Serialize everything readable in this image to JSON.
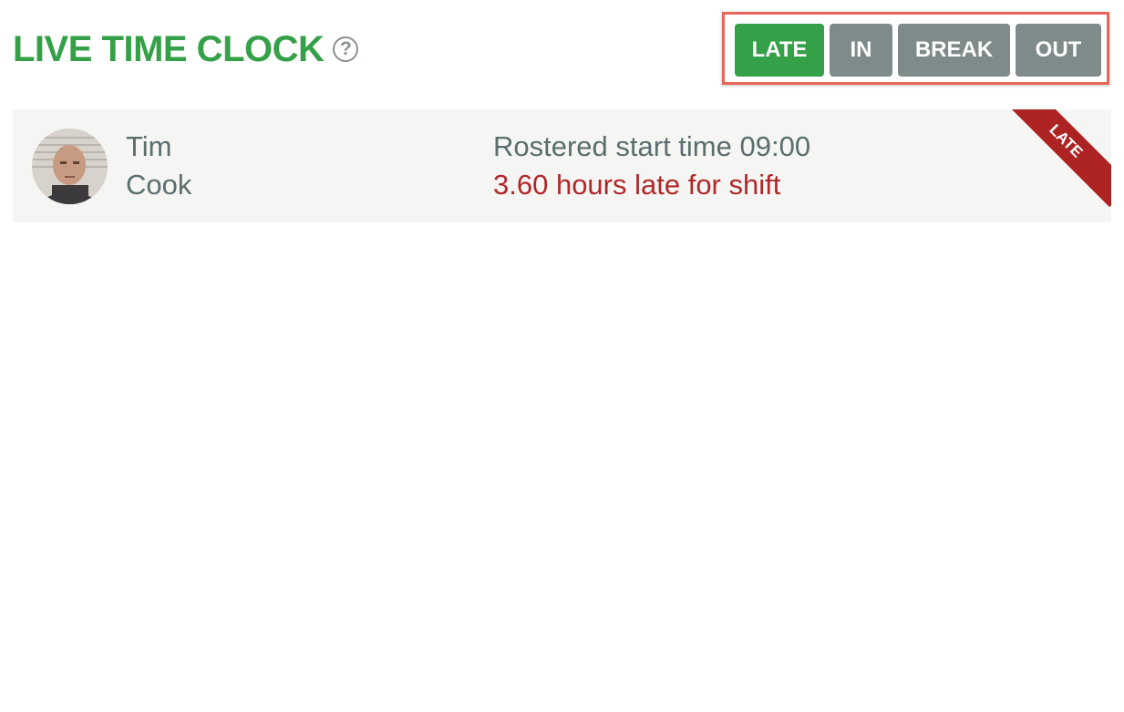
{
  "header": {
    "title": "LIVE TIME CLOCK",
    "help_icon": "question-circle-icon",
    "help_glyph": "?"
  },
  "filters": {
    "late": "LATE",
    "in": "IN",
    "break": "BREAK",
    "out": "OUT",
    "active": "LATE"
  },
  "employee": {
    "first_name": "Tim",
    "last_name": "Cook",
    "rostered_start": "Rostered start time 09:00",
    "late_status": "3.60 hours late for shift",
    "ribbon": "LATE"
  },
  "colors": {
    "brand_green": "#34a047",
    "inactive_grey": "#7f8a8a",
    "late_red": "#ad2222",
    "highlight_border": "#e8665a"
  }
}
